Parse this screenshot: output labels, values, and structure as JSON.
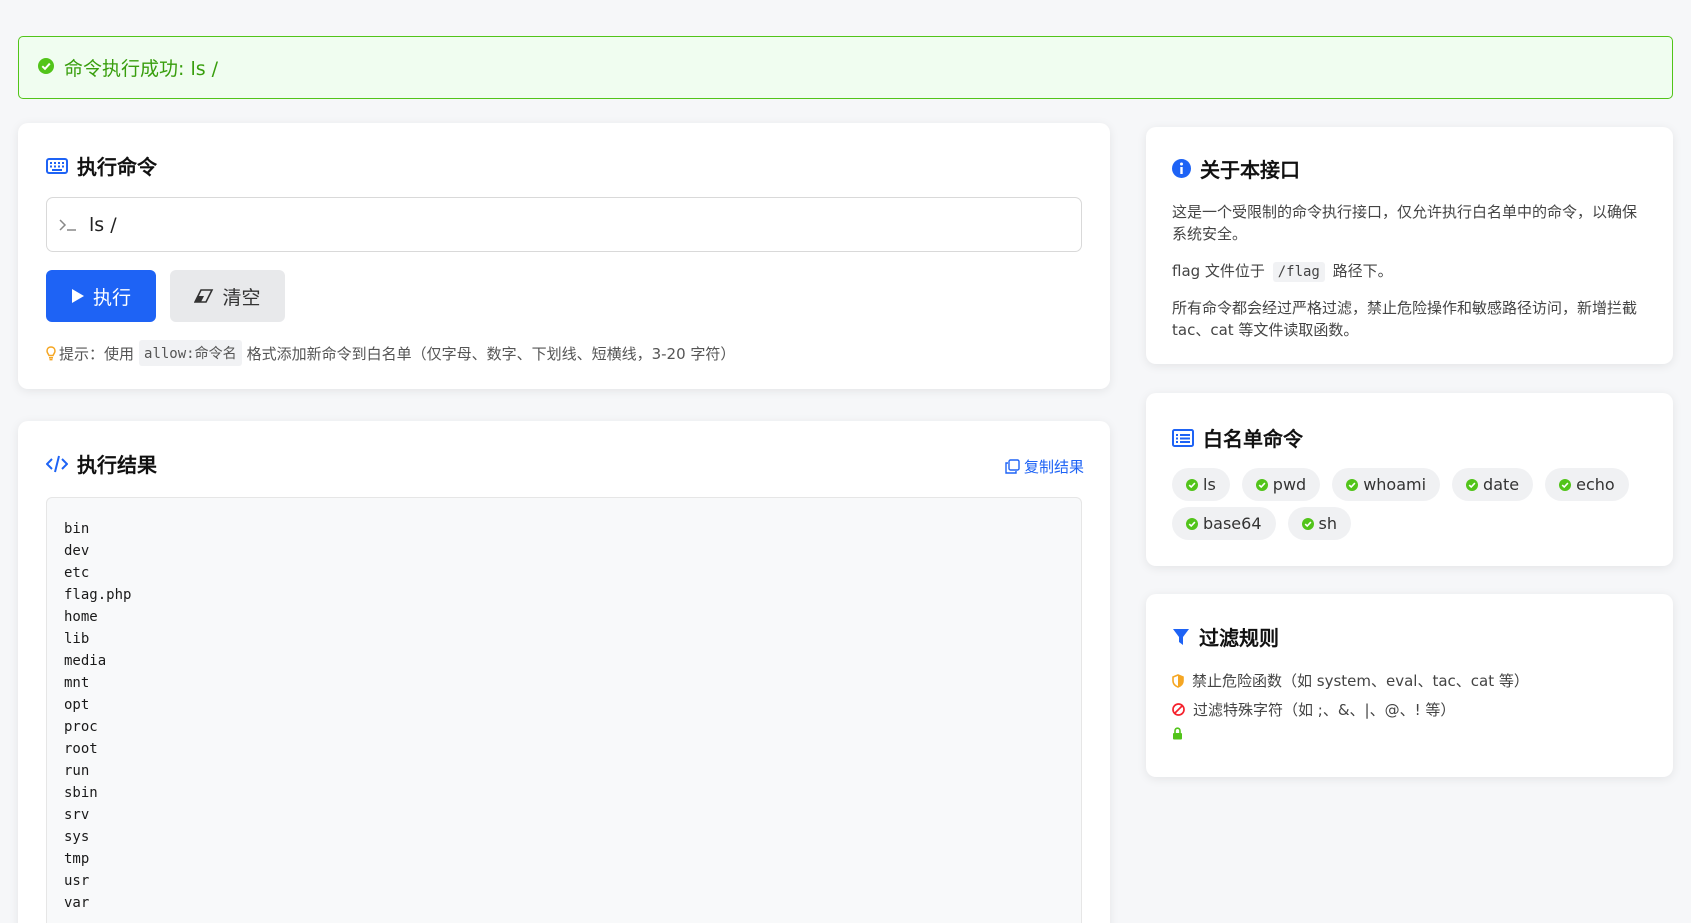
{
  "alert": {
    "text": "命令执行成功: ls /"
  },
  "exec": {
    "title": "执行命令",
    "command_value": "ls /",
    "run_label": "执行",
    "clear_label": "清空",
    "hint_prefix": "提示：使用",
    "hint_code": "allow:命令名",
    "hint_suffix": "格式添加新命令到白名单（仅字母、数字、下划线、短横线，3-20 字符）"
  },
  "result": {
    "title": "执行结果",
    "copy_label": "复制结果",
    "lines": [
      "bin",
      "dev",
      "etc",
      "flag.php",
      "home",
      "lib",
      "media",
      "mnt",
      "opt",
      "proc",
      "root",
      "run",
      "sbin",
      "srv",
      "sys",
      "tmp",
      "usr",
      "var"
    ]
  },
  "about": {
    "title": "关于本接口",
    "p1": "这是一个受限制的命令执行接口，仅允许执行白名单中的命令，以确保系统安全。",
    "p2_prefix": "flag 文件位于",
    "p2_code": "/flag",
    "p2_suffix": "路径下。",
    "p3": "所有命令都会经过严格过滤，禁止危险操作和敏感路径访问，新增拦截 tac、cat 等文件读取函数。"
  },
  "whitelist": {
    "title": "白名单命令",
    "commands": [
      "ls",
      "pwd",
      "whoami",
      "date",
      "echo",
      "base64",
      "sh"
    ]
  },
  "filters": {
    "title": "过滤规则",
    "rule1": "禁止危险函数（如 system、eval、tac、cat 等）",
    "rule2": "过滤特殊字符（如 ;、&、|、@、! 等）",
    "rule3": ""
  },
  "colors": {
    "primary": "#1e63f5",
    "success": "#52c41a",
    "warning": "#f5a623",
    "danger": "#f5222d"
  }
}
